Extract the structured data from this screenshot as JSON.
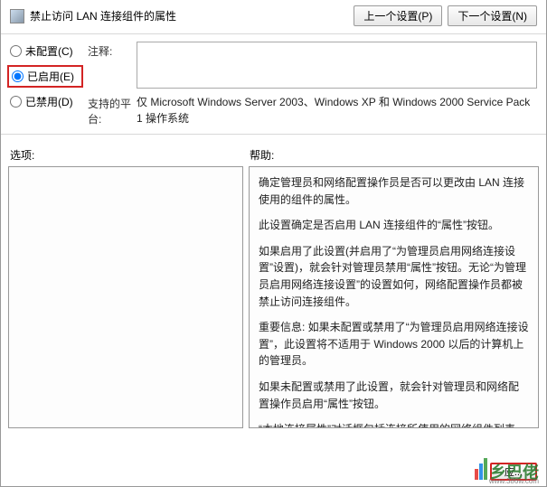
{
  "title": "禁止访问 LAN 连接组件的属性",
  "nav": {
    "prev": "上一个设置(P)",
    "next": "下一个设置(N)"
  },
  "radios": {
    "notConfigured": "未配置(C)",
    "enabled": "已启用(E)",
    "disabled": "已禁用(D)",
    "selected": "enabled"
  },
  "fields": {
    "commentLabel": "注释:",
    "commentValue": "",
    "platformLabel": "支持的平台:",
    "platformValue": "仅 Microsoft Windows Server 2003、Windows XP 和 Windows 2000 Service Pack 1 操作系统"
  },
  "sections": {
    "optionsLabel": "选项:",
    "helpLabel": "帮助:"
  },
  "help": {
    "p1": "确定管理员和网络配置操作员是否可以更改由 LAN 连接使用的组件的属性。",
    "p2": "此设置确定是否启用 LAN 连接组件的“属性”按钮。",
    "p3": "如果启用了此设置(并启用了“为管理员启用网络连接设置”设置)，就会针对管理员禁用“属性”按钮。无论“为管理员启用网络连接设置”的设置如何，网络配置操作员都被禁止访问连接组件。",
    "p4": "重要信息: 如果未配置或禁用了“为管理员启用网络连接设置”，此设置将不适用于 Windows 2000 以后的计算机上的管理员。",
    "p5": "如果未配置或禁用了此设置，就会针对管理员和网络配置操作员启用“属性”按钮。",
    "p6": "“本地连接属性”对话框包括连接所使用的网络组件列表。要查看或更改组件的属性，请单击组件名称，然后单击组件列表下面的“属性”按钮。"
  },
  "footer": {
    "apply": "应..."
  },
  "watermark": {
    "text": "乡巴佬",
    "url": "www.386w.com"
  }
}
